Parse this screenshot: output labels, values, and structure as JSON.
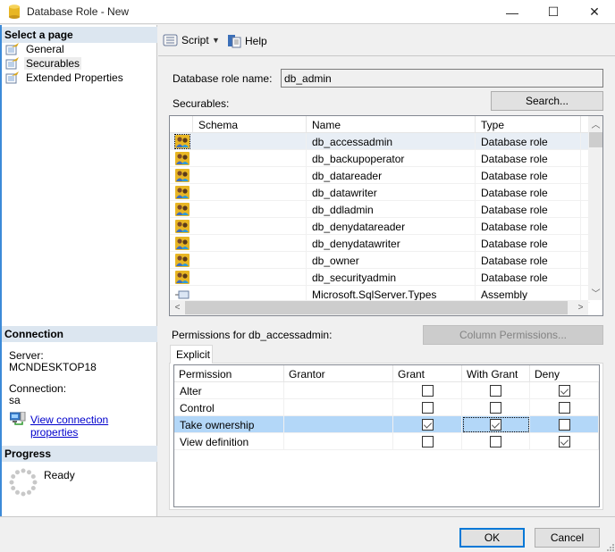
{
  "window": {
    "title": "Database Role - New",
    "minimize_glyph": "—",
    "maximize_glyph": "☐",
    "close_glyph": "✕"
  },
  "left_pane": {
    "select_page_header": "Select a page",
    "pages": [
      {
        "label": "General",
        "icon": "page-settings-icon",
        "selected": false
      },
      {
        "label": "Securables",
        "icon": "page-settings-icon",
        "selected": true
      },
      {
        "label": "Extended Properties",
        "icon": "page-settings-icon",
        "selected": false
      }
    ],
    "connection_header": "Connection",
    "server_label": "Server:",
    "server_value": "MCNDESKTOP18",
    "connection_label": "Connection:",
    "connection_value": "sa",
    "view_connection_link": "View connection properties",
    "progress_header": "Progress",
    "progress_status": "Ready"
  },
  "toolbar": {
    "script_label": "Script",
    "help_label": "Help"
  },
  "form": {
    "role_name_label": "Database role name:",
    "role_name_value": "db_admin",
    "securables_label": "Securables:",
    "search_button": "Search..."
  },
  "securables": {
    "columns": [
      "",
      "Schema",
      "Name",
      "Type"
    ],
    "rows": [
      {
        "icon": "role-icon",
        "schema": "",
        "name": "db_accessadmin",
        "type": "Database role",
        "selected": true
      },
      {
        "icon": "role-icon",
        "schema": "",
        "name": "db_backupoperator",
        "type": "Database role",
        "selected": false
      },
      {
        "icon": "role-icon",
        "schema": "",
        "name": "db_datareader",
        "type": "Database role",
        "selected": false
      },
      {
        "icon": "role-icon",
        "schema": "",
        "name": "db_datawriter",
        "type": "Database role",
        "selected": false
      },
      {
        "icon": "role-icon",
        "schema": "",
        "name": "db_ddladmin",
        "type": "Database role",
        "selected": false
      },
      {
        "icon": "role-icon",
        "schema": "",
        "name": "db_denydatareader",
        "type": "Database role",
        "selected": false
      },
      {
        "icon": "role-icon",
        "schema": "",
        "name": "db_denydatawriter",
        "type": "Database role",
        "selected": false
      },
      {
        "icon": "role-icon",
        "schema": "",
        "name": "db_owner",
        "type": "Database role",
        "selected": false
      },
      {
        "icon": "role-icon",
        "schema": "",
        "name": "db_securityadmin",
        "type": "Database role",
        "selected": false
      },
      {
        "icon": "assembly-icon",
        "schema": "",
        "name": "Microsoft.SqlServer.Types",
        "type": "Assembly",
        "selected": false
      }
    ]
  },
  "permissions": {
    "label": "Permissions for db_accessadmin:",
    "column_permissions_button": "Column Permissions...",
    "tab_label": "Explicit",
    "columns": [
      "Permission",
      "Grantor",
      "Grant",
      "With Grant",
      "Deny"
    ],
    "rows": [
      {
        "permission": "Alter",
        "grantor": "",
        "grant": false,
        "with_grant": false,
        "deny": true,
        "selected": false
      },
      {
        "permission": "Control",
        "grantor": "",
        "grant": false,
        "with_grant": false,
        "deny": false,
        "selected": false
      },
      {
        "permission": "Take ownership",
        "grantor": "",
        "grant": true,
        "with_grant": true,
        "deny": false,
        "selected": true
      },
      {
        "permission": "View definition",
        "grantor": "",
        "grant": false,
        "with_grant": false,
        "deny": true,
        "selected": false
      }
    ]
  },
  "footer": {
    "ok_button": "OK",
    "cancel_button": "Cancel"
  },
  "colors": {
    "selection_blue": "#b3d7f8",
    "default_button_border": "#0078d7",
    "link": "#0000cc",
    "header_band": "#dce6f0"
  }
}
